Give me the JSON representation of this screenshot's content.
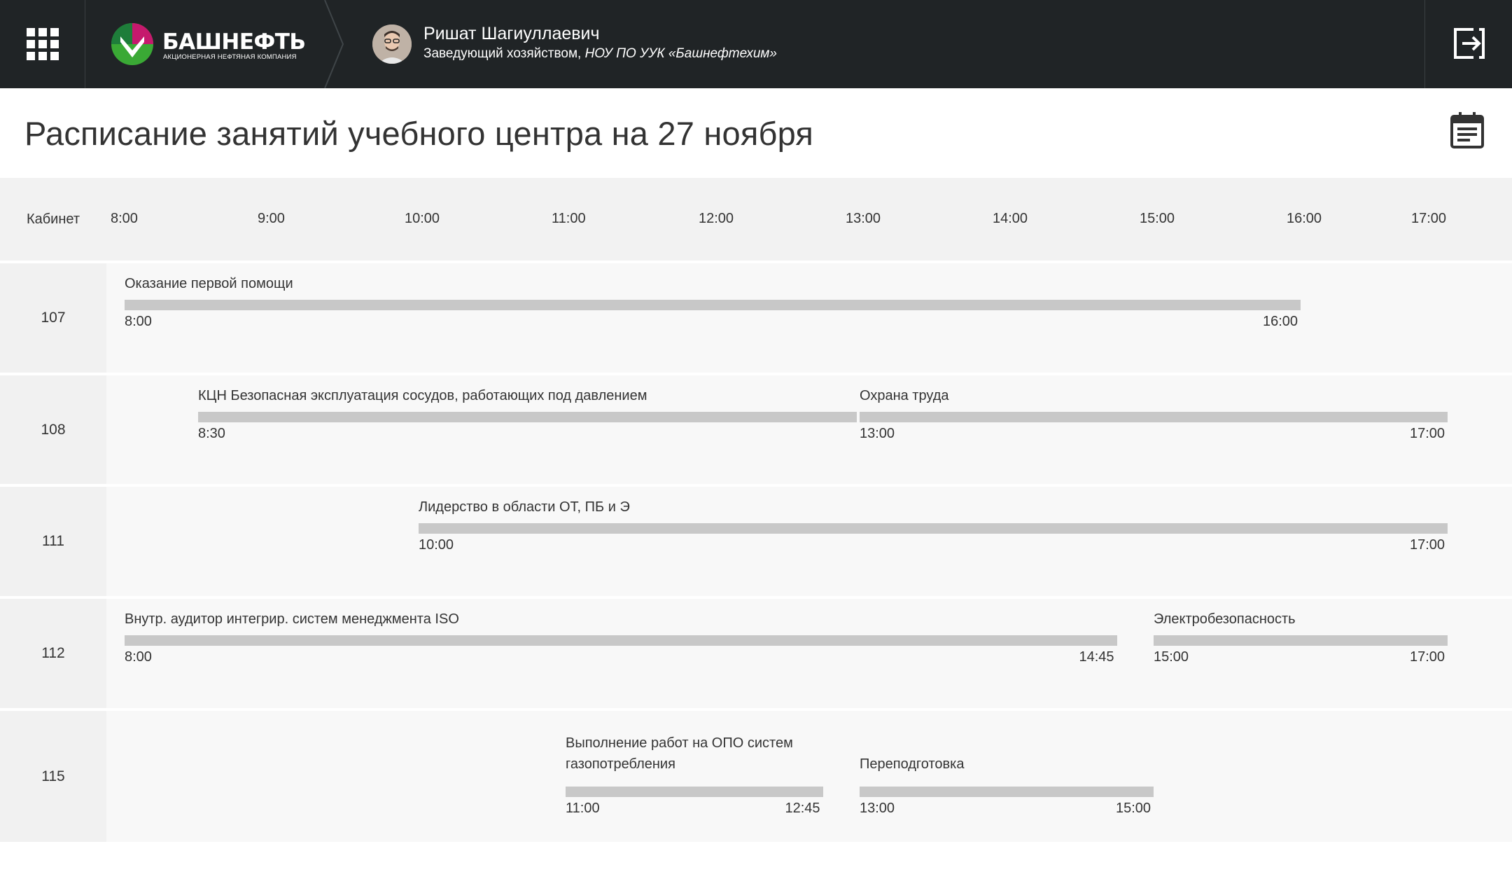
{
  "header": {
    "brand_name": "БАШНЕФТЬ",
    "brand_tagline": "АКЦИОНЕРНАЯ НЕФТЯНАЯ КОМПАНИЯ",
    "user_name": "Ришат Шагиуллаевич",
    "user_role": "Заведующий хозяйством,",
    "user_org": "НОУ ПО УУК «Башнефтехим»"
  },
  "page": {
    "title": "Расписание занятий учебного центра на 27 ноября"
  },
  "schedule": {
    "room_header": "Кабинет",
    "hours": [
      "8:00",
      "9:00",
      "10:00",
      "11:00",
      "12:00",
      "13:00",
      "14:00",
      "15:00",
      "16:00",
      "17:00"
    ],
    "rooms": [
      {
        "room": "107",
        "events": [
          {
            "title": "Оказание первой помощи",
            "start": "8:00",
            "end": "16:00"
          }
        ]
      },
      {
        "room": "108",
        "events": [
          {
            "title": "КЦН Безопасная эксплуатация сосудов, работающих под давлением",
            "start": "8:30",
            "end": ""
          },
          {
            "title": "Охрана труда",
            "start": "13:00",
            "end": "17:00"
          }
        ]
      },
      {
        "room": "111",
        "events": [
          {
            "title": "Лидерство в области ОТ, ПБ и Э",
            "start": "10:00",
            "end": "17:00"
          }
        ]
      },
      {
        "room": "112",
        "events": [
          {
            "title": "Внутр. аудитор интегрир. систем менеджмента ISO",
            "start": "8:00",
            "end": "14:45"
          },
          {
            "title": "Электробезопасность",
            "start": "15:00",
            "end": "17:00"
          }
        ]
      },
      {
        "room": "115",
        "events": [
          {
            "title": "Выполнение работ на ОПО систем",
            "title2": "газопотребления",
            "start": "11:00",
            "end": "12:45"
          },
          {
            "title": "Переподготовка",
            "start": "13:00",
            "end": "15:00"
          }
        ]
      }
    ]
  },
  "colors": {
    "header_bg": "#202426",
    "bar": "#c8c8c8",
    "row_bg": "#f8f8f8",
    "room_bg": "#f1f1f1",
    "logo_green": "#3aa935",
    "logo_magenta": "#c5196d"
  },
  "icons": {
    "apps": "apps-grid-icon",
    "logout": "logout-icon",
    "calendar": "calendar-icon"
  }
}
